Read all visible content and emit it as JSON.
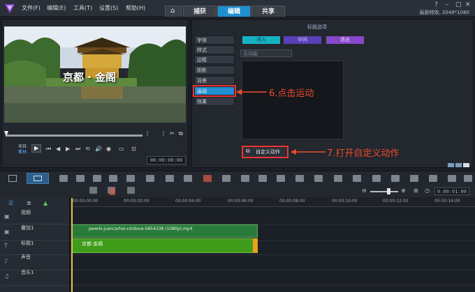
{
  "menu": [
    "文件(F)",
    "编辑(E)",
    "工具(T)",
    "设置(S)",
    "帮助(H)"
  ],
  "tabs": [
    "捕获",
    "编辑",
    "共享"
  ],
  "status": "画面特效, 2048*1080",
  "preview": {
    "video_title": "京都 · 金阁",
    "project_label": "项目-",
    "clip_label": "素材-",
    "timecode": "00:00:00:00"
  },
  "panel": {
    "title": "标题选项",
    "side_tabs": [
      "字体",
      "样式",
      "边框",
      "阴影",
      "背景",
      "运动",
      "效果"
    ],
    "motion_tabs": [
      "进入",
      "中间",
      "退出"
    ],
    "preset_placeholder": "无动画",
    "custom_button": "自定义动作"
  },
  "annotations": {
    "step6": "6.点击运动",
    "step7": "7.打开自定义动作"
  },
  "timeline": {
    "zoom_tc": "0:00:01:00",
    "ruler": [
      "00:00:00:00",
      "00:00:02:00",
      "00:00:04:00",
      "00:00:06:00",
      "00:00:08:00",
      "00:00:10:00",
      "00:00:12:00",
      "00:00:14:00"
    ],
    "tracks": [
      "视频",
      "叠加1",
      "标题1",
      "声音",
      "音乐1"
    ],
    "video_clip": "pexels-juancarlos-córdova-5854338 (1080p).mp4",
    "title_clip": "京都·金阁"
  },
  "colors": {
    "accent": "#1f8fd2",
    "annotation": "#f04b2a"
  }
}
